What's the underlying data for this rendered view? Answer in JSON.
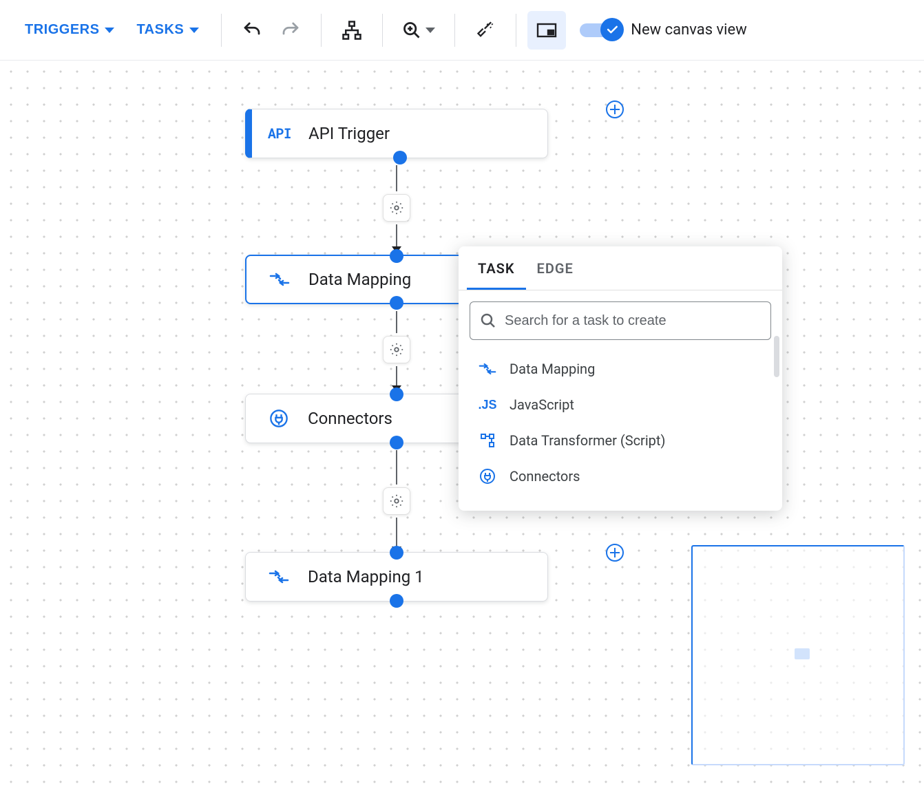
{
  "toolbar": {
    "triggers_label": "TRIGGERS",
    "tasks_label": "TASKS",
    "new_canvas_label": "New canvas view",
    "icons": {
      "undo": "undo-icon",
      "redo": "redo-icon",
      "layout": "hierarchy-icon",
      "zoom": "zoom-icon",
      "wand": "magic-wand-icon",
      "panel": "panel-icon"
    }
  },
  "nodes": {
    "api_trigger": {
      "label": "API Trigger",
      "icon": "api-icon",
      "icon_text": "API"
    },
    "data_mapping": {
      "label": "Data Mapping",
      "icon": "data-mapping-icon"
    },
    "connectors": {
      "label": "Connectors",
      "icon": "connector-icon"
    },
    "data_mapping_1": {
      "label": "Data Mapping 1",
      "icon": "data-mapping-icon"
    }
  },
  "popover": {
    "tabs": {
      "task": "TASK",
      "edge": "EDGE"
    },
    "search_placeholder": "Search for a task to create",
    "items": [
      {
        "label": "Data Mapping",
        "icon": "data-mapping-icon"
      },
      {
        "label": "JavaScript",
        "icon": "js-icon",
        "icon_text": ".JS"
      },
      {
        "label": "Data Transformer (Script)",
        "icon": "data-transformer-icon"
      },
      {
        "label": "Connectors",
        "icon": "connector-icon"
      }
    ]
  }
}
